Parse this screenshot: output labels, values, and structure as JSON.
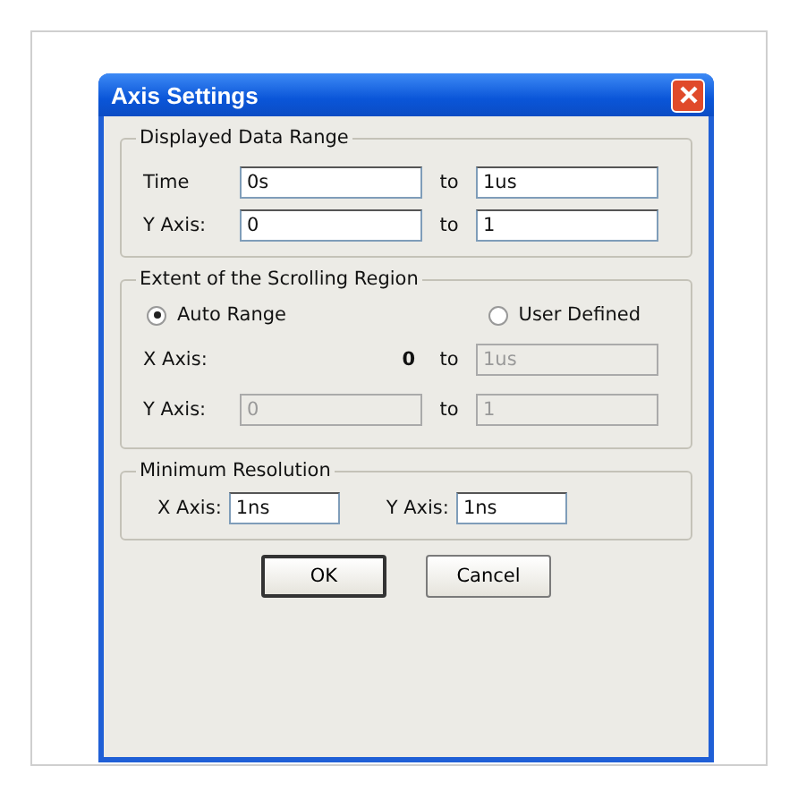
{
  "window": {
    "title": "Axis Settings"
  },
  "displayed_data_range": {
    "title": "Displayed Data Range",
    "rows": [
      {
        "label": "Time",
        "from": {
          "kind": "field",
          "value": "0s",
          "disabled": false
        },
        "to_label": "to",
        "to": {
          "kind": "field",
          "value": "1us",
          "disabled": false
        }
      },
      {
        "label": "Y Axis:",
        "from": {
          "kind": "field",
          "value": "0",
          "disabled": false
        },
        "to_label": "to",
        "to": {
          "kind": "field",
          "value": "1",
          "disabled": false
        }
      }
    ]
  },
  "scrolling_region": {
    "title": "Extent of the Scrolling Region",
    "radios": [
      {
        "label": "Auto Range",
        "selected": true
      },
      {
        "label": "User Defined",
        "selected": false
      }
    ],
    "rows": [
      {
        "label": "X Axis:",
        "from": {
          "kind": "text",
          "value": "0"
        },
        "to_label": "to",
        "to": {
          "kind": "field",
          "value": "1us",
          "disabled": true
        }
      },
      {
        "label": "Y Axis:",
        "from": {
          "kind": "field",
          "value": "0",
          "disabled": true
        },
        "to_label": "to",
        "to": {
          "kind": "field",
          "value": "1",
          "disabled": true
        }
      }
    ]
  },
  "minimum_resolution": {
    "title": "Minimum Resolution",
    "fields": [
      {
        "label": "X Axis:",
        "value": "1ns"
      },
      {
        "label": "Y Axis:",
        "value": "1ns"
      }
    ]
  },
  "buttons": [
    {
      "label": "OK",
      "default": true
    },
    {
      "label": "Cancel",
      "default": false
    }
  ]
}
